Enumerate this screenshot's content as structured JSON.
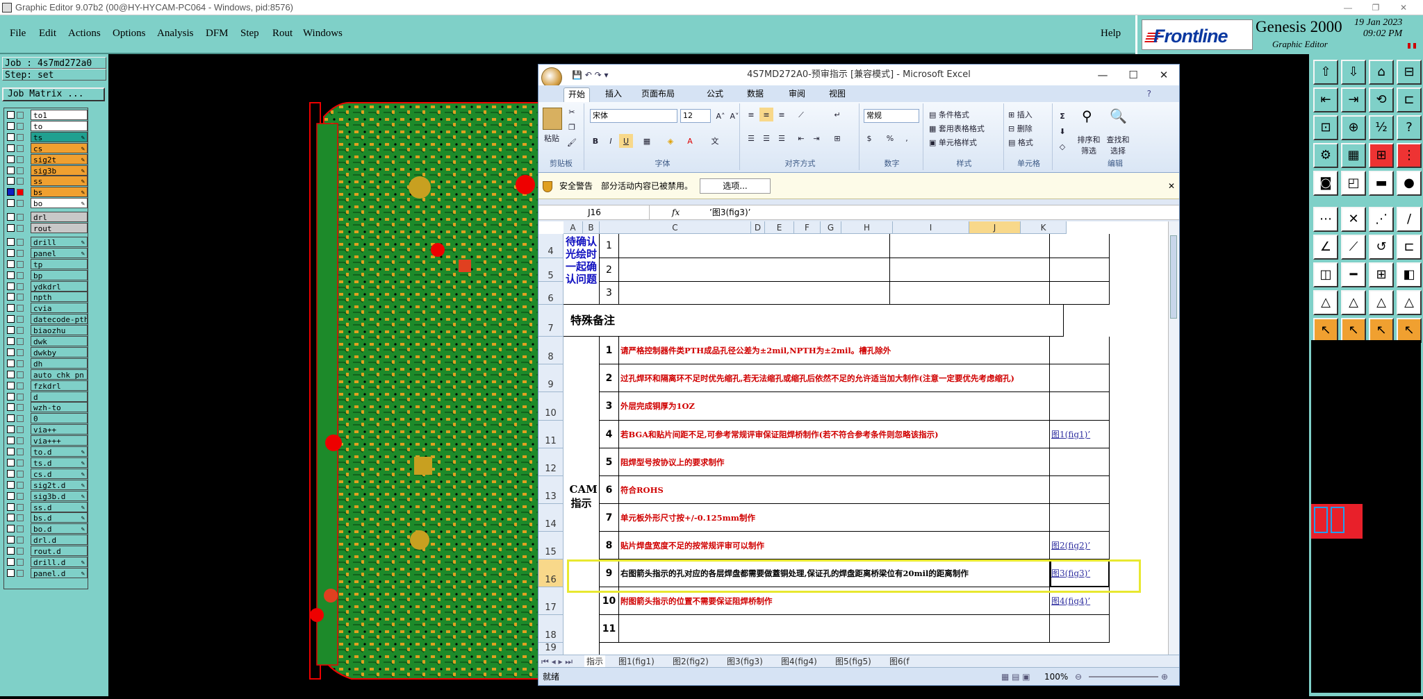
{
  "window": {
    "title": "Graphic Editor 9.07b2 (00@HY-HYCAM-PC064 - Windows, pid:8576)"
  },
  "menu": {
    "items": [
      "File",
      "Edit",
      "Actions",
      "Options",
      "Analysis",
      "DFM",
      "Step",
      "Rout",
      "Windows"
    ],
    "help": "Help"
  },
  "brand": {
    "logo": "Frontline",
    "product": "Genesis 2000",
    "subtitle": "Graphic Editor",
    "date": "19 Jan 2023",
    "time": "09:02 PM"
  },
  "job": {
    "job_line": "Job : 4s7md272a0",
    "step_line": "Step: set",
    "matrix_button": "Job Matrix ..."
  },
  "layers": [
    {
      "name": "to1",
      "color": "#ffffff",
      "pen": ""
    },
    {
      "name": "to",
      "color": "#ffffff",
      "pen": ""
    },
    {
      "name": "ts",
      "color": "#20a090",
      "pen": "✎"
    },
    {
      "name": "cs",
      "color": "#f0a030",
      "pen": "✎"
    },
    {
      "name": "sig2t",
      "color": "#f0a030",
      "pen": "✎"
    },
    {
      "name": "sig3b",
      "color": "#f0a030",
      "pen": "✎"
    },
    {
      "name": "ss",
      "color": "#f0a030",
      "pen": "✎"
    },
    {
      "name": "bs",
      "color": "#f0a030",
      "pen": "✎"
    },
    {
      "name": "bo",
      "color": "#ffffff",
      "pen": "✎"
    },
    {
      "name": "drl",
      "color": "#c8c8c8",
      "pen": ""
    },
    {
      "name": "rout",
      "color": "#c8c8c8",
      "pen": ""
    },
    {
      "name": "drill",
      "color": "#7fd0c8",
      "pen": "✎"
    },
    {
      "name": "panel",
      "color": "#7fd0c8",
      "pen": "✎"
    },
    {
      "name": "tp",
      "color": "#7fd0c8",
      "pen": ""
    },
    {
      "name": "bp",
      "color": "#7fd0c8",
      "pen": ""
    },
    {
      "name": "ydkdrl",
      "color": "#7fd0c8",
      "pen": ""
    },
    {
      "name": "npth",
      "color": "#7fd0c8",
      "pen": ""
    },
    {
      "name": "cvia",
      "color": "#7fd0c8",
      "pen": ""
    },
    {
      "name": "datecode-pth",
      "color": "#7fd0c8",
      "pen": ""
    },
    {
      "name": "biaozhu",
      "color": "#7fd0c8",
      "pen": ""
    },
    {
      "name": "dwk",
      "color": "#7fd0c8",
      "pen": ""
    },
    {
      "name": "dwkby",
      "color": "#7fd0c8",
      "pen": ""
    },
    {
      "name": "dh",
      "color": "#7fd0c8",
      "pen": ""
    },
    {
      "name": "auto_chk_pn",
      "color": "#7fd0c8",
      "pen": ""
    },
    {
      "name": "fzkdrl",
      "color": "#7fd0c8",
      "pen": ""
    },
    {
      "name": "d",
      "color": "#7fd0c8",
      "pen": ""
    },
    {
      "name": "wzh-to",
      "color": "#7fd0c8",
      "pen": ""
    },
    {
      "name": "0",
      "color": "#7fd0c8",
      "pen": ""
    },
    {
      "name": "via++",
      "color": "#7fd0c8",
      "pen": ""
    },
    {
      "name": "via+++",
      "color": "#7fd0c8",
      "pen": ""
    },
    {
      "name": "to.d",
      "color": "#7fd0c8",
      "pen": "✎"
    },
    {
      "name": "ts.d",
      "color": "#7fd0c8",
      "pen": "✎"
    },
    {
      "name": "cs.d",
      "color": "#7fd0c8",
      "pen": "✎"
    },
    {
      "name": "sig2t.d",
      "color": "#7fd0c8",
      "pen": "✎"
    },
    {
      "name": "sig3b.d",
      "color": "#7fd0c8",
      "pen": "✎"
    },
    {
      "name": "ss.d",
      "color": "#7fd0c8",
      "pen": "✎"
    },
    {
      "name": "bs.d",
      "color": "#7fd0c8",
      "pen": "✎"
    },
    {
      "name": "bo.d",
      "color": "#7fd0c8",
      "pen": "✎"
    },
    {
      "name": "drl.d",
      "color": "#7fd0c8",
      "pen": ""
    },
    {
      "name": "rout.d",
      "color": "#7fd0c8",
      "pen": ""
    },
    {
      "name": "drill.d",
      "color": "#7fd0c8",
      "pen": "✎"
    },
    {
      "name": "panel.d",
      "color": "#7fd0c8",
      "pen": "✎"
    }
  ],
  "excel": {
    "title": "4S7MD272A0-预审指示 [兼容模式] - Microsoft Excel",
    "tabs": [
      "开始",
      "插入",
      "页面布局",
      "公式",
      "数据",
      "审阅",
      "视图"
    ],
    "ribbon": {
      "paste": "粘贴",
      "clipboard": "剪贴板",
      "font_name": "宋体",
      "font_size": "12",
      "font": "字体",
      "alignment": "对齐方式",
      "number_format": "常规",
      "number": "数字",
      "cond_format": "条件格式",
      "table_format": "套用表格格式",
      "cell_style": "单元格样式",
      "styles": "样式",
      "insert": "插入",
      "delete": "删除",
      "format": "格式",
      "cells": "单元格",
      "sort": "排序和筛选",
      "find": "查找和选择",
      "editing": "编辑"
    },
    "security": {
      "title": "安全警告",
      "message": "部分活动内容已被禁用。",
      "options": "选项..."
    },
    "name_box": "J16",
    "fx": "fx",
    "formula": "’图3(fig3)’",
    "columns": [
      "A",
      "B",
      "C",
      "D",
      "E",
      "F",
      "G",
      "H",
      "I",
      "J",
      "K"
    ],
    "top_label": "待确认光绘时一起确认问题",
    "special_label": "特殊备注",
    "cam_label": "CAM指示",
    "top_rows": [
      {
        "row": "4",
        "n": "1"
      },
      {
        "row": "5",
        "n": "2"
      },
      {
        "row": "6",
        "n": "3"
      }
    ],
    "rows": [
      {
        "row": "8",
        "n": "1",
        "text": "请严格控制器件类PTH成品孔径公差为±2mil,NPTH为±2mil。槽孔除外",
        "link": ""
      },
      {
        "row": "9",
        "n": "2",
        "text": "过孔焊环和隔离环不足时优先缩孔,若无法缩孔或缩孔后依然不足的允许适当加大制作(注意一定要优先考虑缩孔)",
        "link": ""
      },
      {
        "row": "10",
        "n": "3",
        "text": "外层完成铜厚为1OZ",
        "link": ""
      },
      {
        "row": "11",
        "n": "4",
        "text": "若BGA和贴片间距不足,可参考常规评审保证阻焊桥制作(若不符合参考条件则忽略该指示)",
        "link": "图1(fig1)’"
      },
      {
        "row": "12",
        "n": "5",
        "text": "阻焊型号按协议上的要求制作",
        "link": ""
      },
      {
        "row": "13",
        "n": "6",
        "text": "符合ROHS",
        "link": ""
      },
      {
        "row": "14",
        "n": "7",
        "text": "单元板外形尺寸按+/-0.125mm制作",
        "link": ""
      },
      {
        "row": "15",
        "n": "8",
        "text": "贴片焊盘宽度不足的按常规评审可以制作",
        "link": "图2(fig2)’"
      },
      {
        "row": "16",
        "n": "9",
        "text": "右图箭头指示的孔对应的各层焊盘都需要做蓋铜处理,保证孔的焊盘距离桥梁位有20mil的距离制作",
        "link": "图3(fig3)’"
      },
      {
        "row": "17",
        "n": "10",
        "text": "附图箭头指示的位置不需要保证阻焊桥制作",
        "link": "图4(fig4)’"
      },
      {
        "row": "18",
        "n": "11",
        "text": "",
        "link": ""
      }
    ],
    "sheets": [
      "指示",
      "图1(fig1)",
      "图2(fig2)",
      "图3(fig3)",
      "图4(fig4)",
      "图5(fig5)",
      "图6(f"
    ],
    "status": "就绪",
    "zoom": "100%"
  },
  "colors": {
    "genesis_bg": "#7fd0c8",
    "excel_accent": "#1f4e8c",
    "highlight": "#e8e830",
    "red_text": "#d00000"
  }
}
